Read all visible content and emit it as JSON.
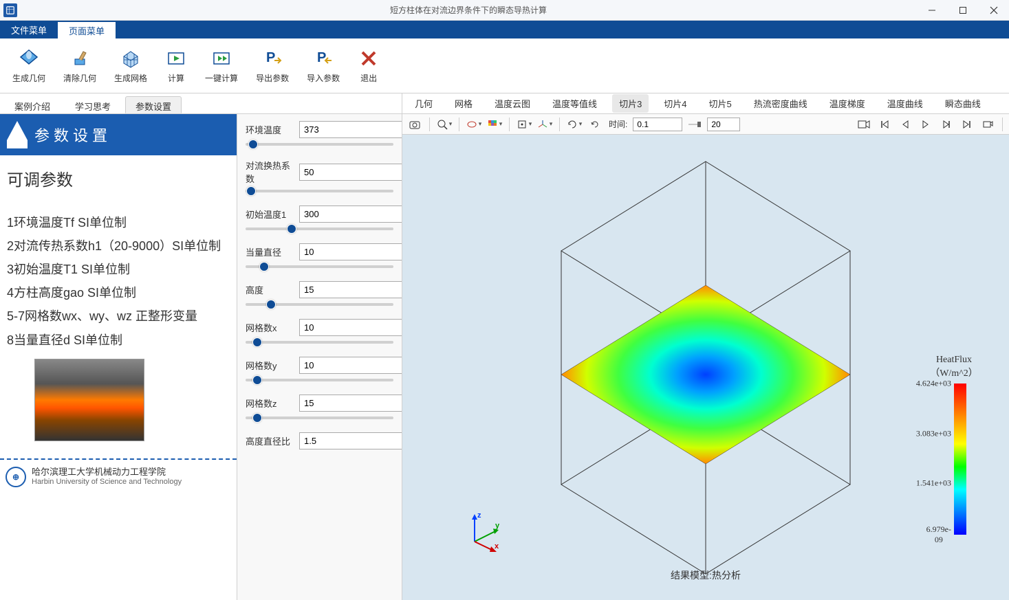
{
  "window": {
    "title": "短方柱体在对流边界条件下的瞬态导热计算"
  },
  "menu_tabs": {
    "file": "文件菜单",
    "page": "页面菜单"
  },
  "ribbon": {
    "create_geom": "生成几何",
    "clear_geom": "清除几何",
    "create_mesh": "生成网格",
    "compute": "计算",
    "one_click": "一键计算",
    "export_params": "导出参数",
    "import_params": "导入参数",
    "exit": "退出"
  },
  "subtabs": {
    "case_intro": "案例介绍",
    "study": "学习思考",
    "param_setting": "参数设置"
  },
  "banner": {
    "title": "参数设置"
  },
  "info": {
    "heading": "可调参数",
    "l1": "1环境温度Tf  SI单位制",
    "l2": "2对流传热系数h1（20-9000）SI单位制",
    "l3": "3初始温度T1  SI单位制",
    "l4": "4方柱高度gao  SI单位制",
    "l5": "5-7网格数wx、wy、wz 正整形变量",
    "l6": "8当量直径d SI单位制"
  },
  "brand": {
    "cn": "哈尔滨理工大学机械动力工程学院",
    "en": "Harbin University of Science and Technology"
  },
  "params": {
    "env_temp": {
      "label": "环境温度",
      "value": "373"
    },
    "conv_coef": {
      "label": "对流换热系数",
      "value": "50"
    },
    "init_temp": {
      "label": "初始温度1",
      "value": "300"
    },
    "eq_diam": {
      "label": "当量直径",
      "value": "10"
    },
    "height": {
      "label": "高度",
      "value": "15"
    },
    "mesh_x": {
      "label": "网格数x",
      "value": "10"
    },
    "mesh_y": {
      "label": "网格数y",
      "value": "10"
    },
    "mesh_z": {
      "label": "网格数z",
      "value": "15"
    },
    "hd_ratio": {
      "label": "高度直径比",
      "value": "1.5"
    }
  },
  "result_tabs": {
    "geom": "几何",
    "mesh": "网格",
    "temp_cloud": "温度云图",
    "temp_iso": "温度等值线",
    "slice3": "切片3",
    "slice4": "切片4",
    "slice5": "切片5",
    "heatflux_curve": "热流密度曲线",
    "temp_grad": "温度梯度",
    "temp_curve": "温度曲线",
    "transient_curve": "瞬态曲线"
  },
  "viewer": {
    "time_label": "时间:",
    "time_value": "0.1",
    "frame_value": "20"
  },
  "legend": {
    "title": "HeatFlux",
    "unit": "（W/m^2）",
    "t1": "4.624e+03",
    "t2": "3.083e+03",
    "t3": "1.541e+03",
    "t4": "6.979e-09"
  },
  "axis": {
    "x": "x",
    "y": "y",
    "z": "z"
  },
  "footer_result": "结果模型:热分析"
}
